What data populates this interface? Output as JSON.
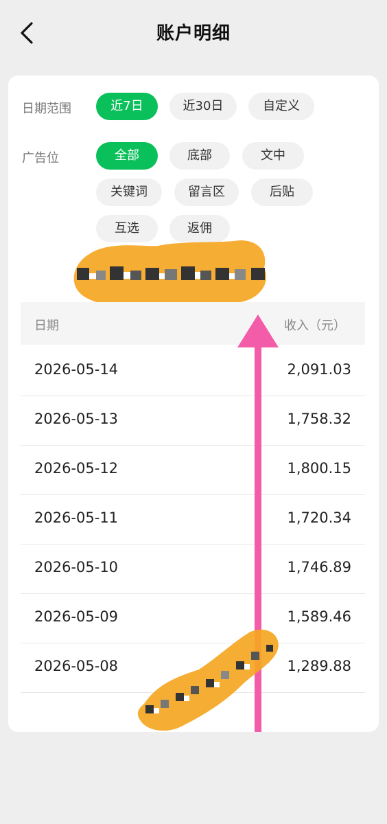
{
  "header": {
    "back_icon": "chevron-left-icon",
    "title": "账户明细"
  },
  "filters": {
    "date_range": {
      "label": "日期范围",
      "options": [
        "近7日",
        "近30日",
        "自定义"
      ],
      "selected": "近7日"
    },
    "ad_slot": {
      "label": "广告位",
      "options": [
        "全部",
        "底部",
        "文中",
        "关键词",
        "留言区",
        "后贴",
        "互选",
        "返佣"
      ],
      "selected": "全部"
    }
  },
  "table": {
    "columns": [
      "日期",
      "收入（元）"
    ],
    "rows": [
      {
        "date": "2026-05-14",
        "amount": "2,091.03"
      },
      {
        "date": "2026-05-13",
        "amount": "1,758.32"
      },
      {
        "date": "2026-05-12",
        "amount": "1,800.15"
      },
      {
        "date": "2026-05-11",
        "amount": "1,720.34"
      },
      {
        "date": "2026-05-10",
        "amount": "1,746.89"
      },
      {
        "date": "2026-05-09",
        "amount": "1,589.46"
      },
      {
        "date": "2026-05-08",
        "amount": "1,289.88"
      }
    ]
  },
  "colors": {
    "accent_green": "#09c05a",
    "annotation_pink": "#f25ca8",
    "scribble_orange": "#f5a623"
  }
}
